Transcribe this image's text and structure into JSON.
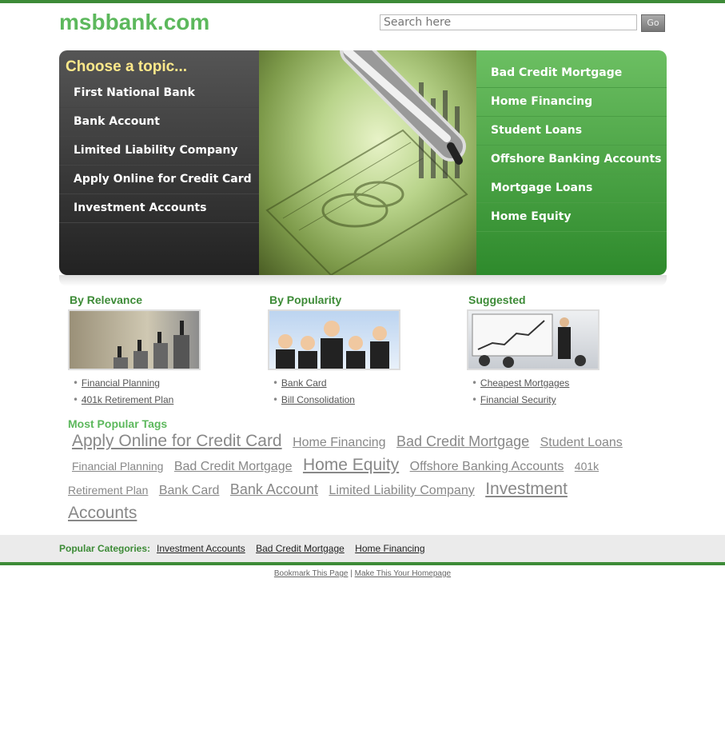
{
  "site": {
    "logo": "msbbank.com"
  },
  "search": {
    "placeholder": "Search here",
    "button_label": "Go"
  },
  "banner": {
    "left_title": "Choose a topic...",
    "left_items": [
      "First National Bank",
      "Bank Account",
      "Limited Liability Company",
      "Apply Online for Credit Card",
      "Investment Accounts"
    ],
    "right_items": [
      "Bad Credit Mortgage",
      "Home Financing",
      "Student Loans",
      "Offshore Banking Accounts",
      "Mortgage Loans",
      "Home Equity"
    ]
  },
  "columns": [
    {
      "title": "By Relevance",
      "links": [
        "Financial Planning",
        "401k Retirement Plan"
      ]
    },
    {
      "title": "By Popularity",
      "links": [
        "Bank Card",
        "Bill Consolidation"
      ]
    },
    {
      "title": "Suggested",
      "links": [
        "Cheapest Mortgages",
        "Financial Security"
      ]
    }
  ],
  "tags": {
    "title": "Most Popular Tags",
    "items": [
      {
        "label": "Apply Online for Credit Card",
        "size": "xl"
      },
      {
        "label": "Home Financing",
        "size": "m"
      },
      {
        "label": "Bad Credit Mortgage",
        "size": "l"
      },
      {
        "label": "Student Loans",
        "size": "m"
      },
      {
        "label": "Financial Planning",
        "size": "s"
      },
      {
        "label": "Bad Credit Mortgage",
        "size": "m"
      },
      {
        "label": "Home Equity",
        "size": "xl"
      },
      {
        "label": "Offshore Banking Accounts",
        "size": "m"
      },
      {
        "label": "401k Retirement Plan",
        "size": "s"
      },
      {
        "label": "Bank Card",
        "size": "m"
      },
      {
        "label": "Bank Account",
        "size": "l"
      },
      {
        "label": "Limited Liability Company",
        "size": "m"
      },
      {
        "label": "Investment Accounts",
        "size": "xl"
      }
    ]
  },
  "footer": {
    "label": "Popular Categories:",
    "links": [
      "Investment Accounts",
      "Bad Credit Mortgage",
      "Home Financing"
    ],
    "bottom_links": [
      "Bookmark This Page",
      "Make This Your Homepage"
    ],
    "separator": "|"
  },
  "colors": {
    "accent": "#3d8b37",
    "logo": "#5cb85c",
    "banner_title": "#ffe98a"
  }
}
